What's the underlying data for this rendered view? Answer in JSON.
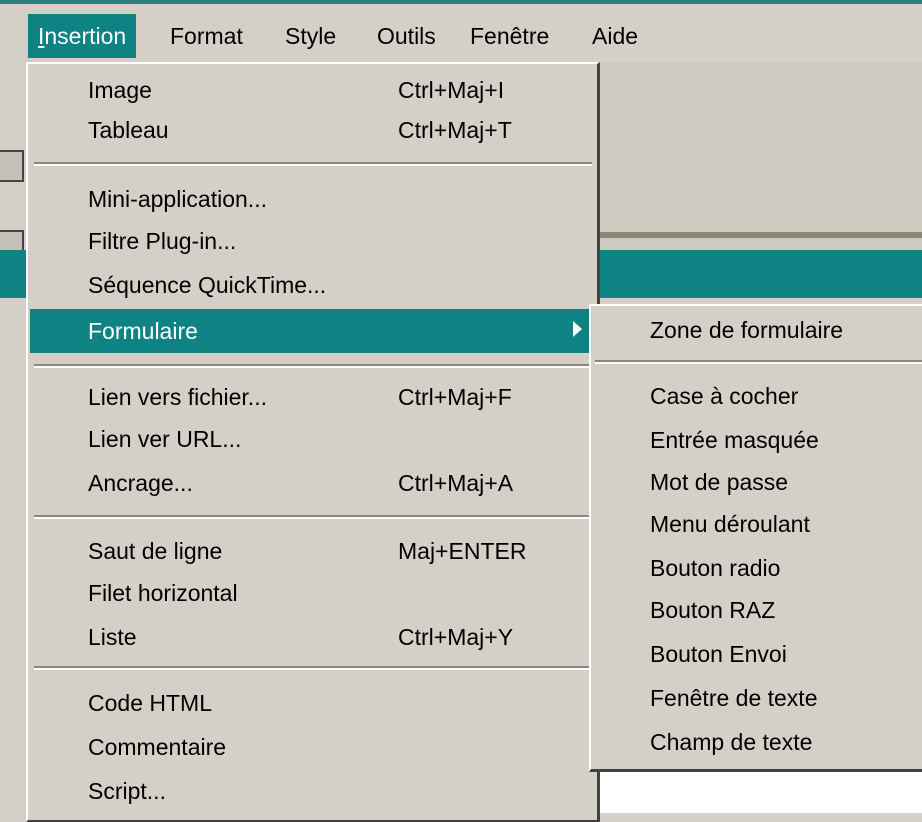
{
  "menubar": {
    "items": [
      {
        "label": "Insertion",
        "mnemonic": "I",
        "active": true
      },
      {
        "label": "Format",
        "mnemonic": "m"
      },
      {
        "label": "Style",
        "mnemonic": "S"
      },
      {
        "label": "Outils",
        "mnemonic": "O"
      },
      {
        "label": "Fenêtre",
        "mnemonic": "n"
      },
      {
        "label": "Aide",
        "mnemonic": "A"
      }
    ]
  },
  "insertion_menu": {
    "items": [
      {
        "label": "Image",
        "shortcut": "Ctrl+Maj+I"
      },
      {
        "label": "Tableau",
        "shortcut": "Ctrl+Maj+T"
      },
      {
        "label": "Mini-application...",
        "shortcut": ""
      },
      {
        "label": "Filtre Plug-in...",
        "shortcut": ""
      },
      {
        "label": "Séquence QuickTime...",
        "shortcut": ""
      },
      {
        "label": "Formulaire",
        "shortcut": "",
        "has_submenu": true,
        "highlighted": true
      },
      {
        "label": "Lien vers fichier...",
        "shortcut": "Ctrl+Maj+F"
      },
      {
        "label": "Lien ver URL...",
        "shortcut": ""
      },
      {
        "label": "Ancrage...",
        "shortcut": "Ctrl+Maj+A"
      },
      {
        "label": "Saut de ligne",
        "shortcut": "Maj+ENTER"
      },
      {
        "label": "Filet horizontal",
        "shortcut": ""
      },
      {
        "label": "Liste",
        "shortcut": "Ctrl+Maj+Y"
      },
      {
        "label": "Code HTML",
        "shortcut": ""
      },
      {
        "label": "Commentaire",
        "shortcut": ""
      },
      {
        "label": "Script...",
        "shortcut": ""
      }
    ]
  },
  "formulaire_submenu": {
    "items": [
      {
        "label": "Zone de formulaire"
      },
      {
        "label": "Case à cocher"
      },
      {
        "label": "Entrée masquée"
      },
      {
        "label": "Mot de passe"
      },
      {
        "label": "Menu déroulant"
      },
      {
        "label": "Bouton radio"
      },
      {
        "label": "Bouton RAZ"
      },
      {
        "label": "Bouton Envoi"
      },
      {
        "label": "Fenêtre de texte"
      },
      {
        "label": "Champ de texte"
      }
    ]
  },
  "colors": {
    "highlight": "#0f8383",
    "menu_face": "#d4d0c8"
  }
}
